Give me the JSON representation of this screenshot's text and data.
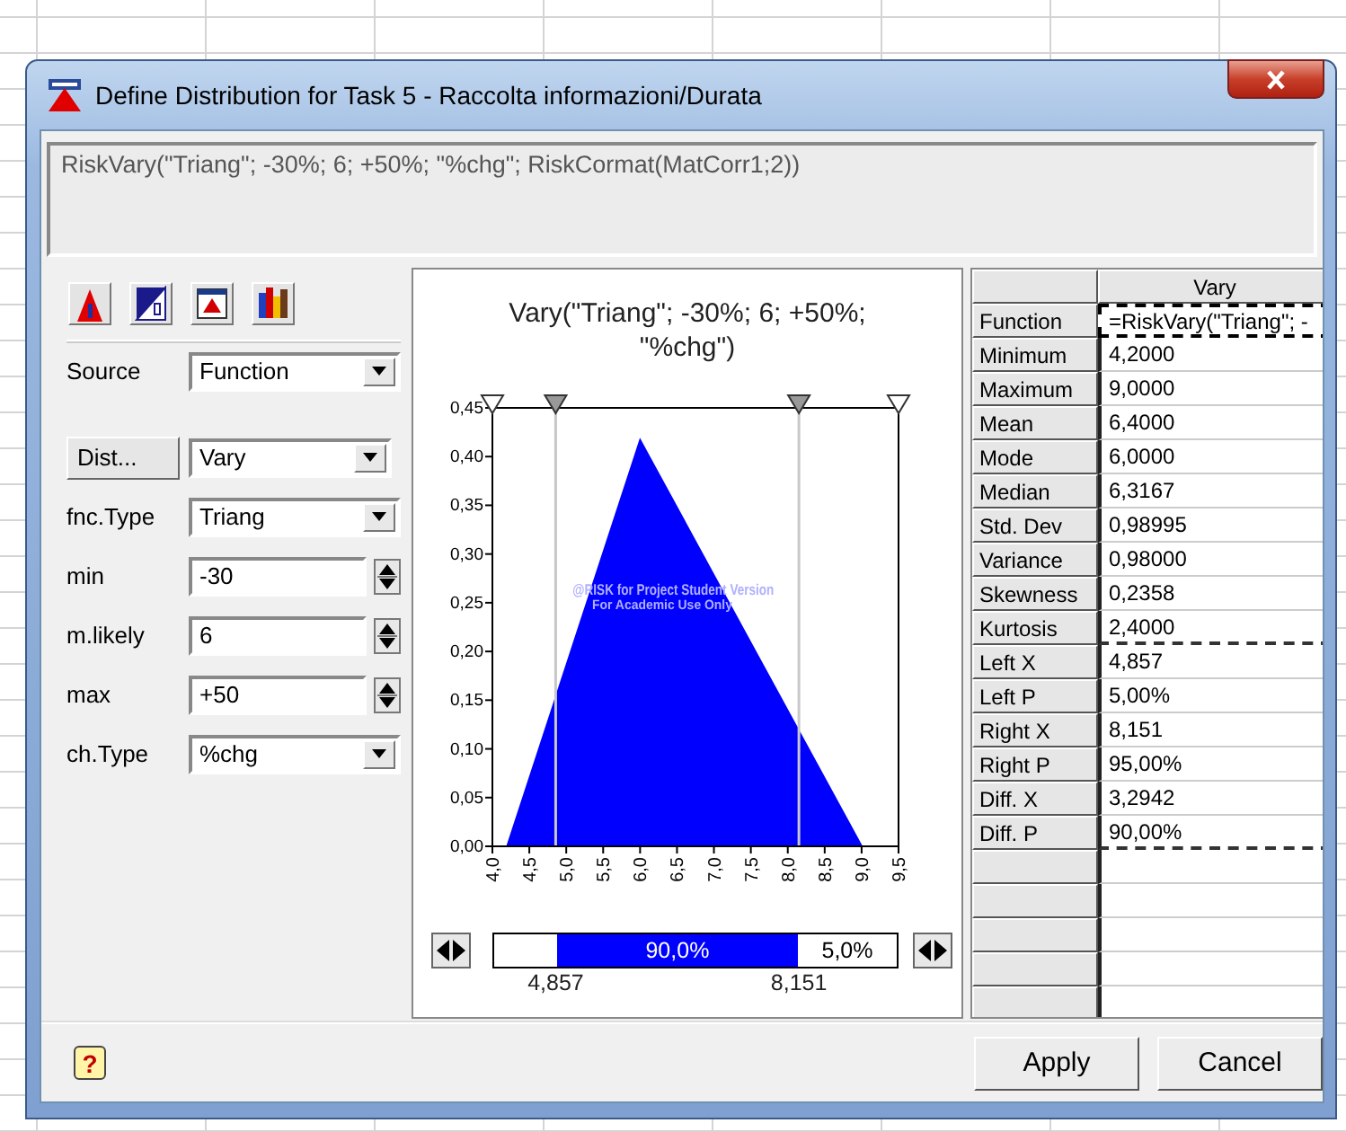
{
  "window": {
    "title": "Define Distribution for Task 5 - Raccolta informazioni/Durata"
  },
  "formula": "RiskVary(\"Triang\"; -30%; 6; +50%; \"%chg\"; RiskCormat(MatCorr1;2))",
  "parameters": [
    {
      "kind": "dropdown",
      "label": "Source",
      "value": "Function"
    },
    {
      "kind": "button-dropdown",
      "label": "Dist...",
      "value": "Vary"
    },
    {
      "kind": "dropdown",
      "label": "fnc.Type",
      "value": "Triang"
    },
    {
      "kind": "spinner",
      "label": "min",
      "value": "-30"
    },
    {
      "kind": "spinner",
      "label": "m.likely",
      "value": "6"
    },
    {
      "kind": "spinner",
      "label": "max",
      "value": "+50"
    },
    {
      "kind": "dropdown",
      "label": "ch.Type",
      "value": "%chg"
    }
  ],
  "chart": {
    "watermark": [
      "@RISK for Project Student Version",
      "For Academic Use Only"
    ],
    "chart_data": {
      "type": "area",
      "title": "Vary(\"Triang\"; -30%; 6; +50%; \"%chg\")",
      "x": [
        4.2,
        6.0,
        9.0
      ],
      "values": [
        0,
        0.417,
        0
      ],
      "xlim": [
        4,
        9.5
      ],
      "ylim": [
        0,
        0.45
      ],
      "xticks": [
        {
          "value": 4,
          "label": "4,0"
        },
        {
          "value": 4.5,
          "label": "4,5"
        },
        {
          "value": 5,
          "label": "5,0"
        },
        {
          "value": 5.5,
          "label": "5,5"
        },
        {
          "value": 6,
          "label": "6,0"
        },
        {
          "value": 6.5,
          "label": "6,5"
        },
        {
          "value": 7,
          "label": "7,0"
        },
        {
          "value": 7.5,
          "label": "7,5"
        },
        {
          "value": 8,
          "label": "8,0"
        },
        {
          "value": 8.5,
          "label": "8,5"
        },
        {
          "value": 9,
          "label": "9,0"
        },
        {
          "value": 9.5,
          "label": "9,5"
        }
      ],
      "yticks": [
        {
          "value": 0,
          "label": "0,00"
        },
        {
          "value": 0.05,
          "label": "0,05"
        },
        {
          "value": 0.1,
          "label": "0,10"
        },
        {
          "value": 0.15,
          "label": "0,15"
        },
        {
          "value": 0.2,
          "label": "0,20"
        },
        {
          "value": 0.25,
          "label": "0,25"
        },
        {
          "value": 0.3,
          "label": "0,30"
        },
        {
          "value": 0.35,
          "label": "0,35"
        },
        {
          "value": 0.4,
          "label": "0,40"
        },
        {
          "value": 0.45,
          "label": "0,45"
        }
      ],
      "ref_lines": [
        {
          "axis": "x",
          "value": 4.857,
          "label": "4,857"
        },
        {
          "axis": "x",
          "value": 8.151,
          "label": "8,151"
        }
      ]
    },
    "slider": {
      "middle_label": "90,0%",
      "right_label": "5,0%"
    }
  },
  "table": {
    "column_header": "Vary",
    "rows": [
      {
        "label": "Function",
        "value": "=RiskVary(\"Triang\"; -",
        "selected": true,
        "separator_after": false
      },
      {
        "label": "Minimum",
        "value": "4,2000",
        "selected": false,
        "separator_after": false
      },
      {
        "label": "Maximum",
        "value": "9,0000",
        "selected": false,
        "separator_after": false
      },
      {
        "label": "Mean",
        "value": "6,4000",
        "selected": false,
        "separator_after": false
      },
      {
        "label": "Mode",
        "value": "6,0000",
        "selected": false,
        "separator_after": false
      },
      {
        "label": "Median",
        "value": "6,3167",
        "selected": false,
        "separator_after": false
      },
      {
        "label": "Std. Dev",
        "value": "0,98995",
        "selected": false,
        "separator_after": false
      },
      {
        "label": "Variance",
        "value": "0,98000",
        "selected": false,
        "separator_after": false
      },
      {
        "label": "Skewness",
        "value": "0,2358",
        "selected": false,
        "separator_after": false
      },
      {
        "label": "Kurtosis",
        "value": "2,4000",
        "selected": false,
        "separator_after": true
      },
      {
        "label": "Left X",
        "value": "4,857",
        "selected": false,
        "separator_after": false
      },
      {
        "label": "Left P",
        "value": "5,00%",
        "selected": false,
        "separator_after": false
      },
      {
        "label": "Right X",
        "value": "8,151",
        "selected": false,
        "separator_after": false
      },
      {
        "label": "Right P",
        "value": "95,00%",
        "selected": false,
        "separator_after": false
      },
      {
        "label": "Diff. X",
        "value": "3,2942",
        "selected": false,
        "separator_after": false
      },
      {
        "label": "Diff. P",
        "value": "90,00%",
        "selected": false,
        "separator_after": true
      }
    ]
  },
  "help": "?",
  "buttons": [
    "Apply",
    "Cancel"
  ]
}
